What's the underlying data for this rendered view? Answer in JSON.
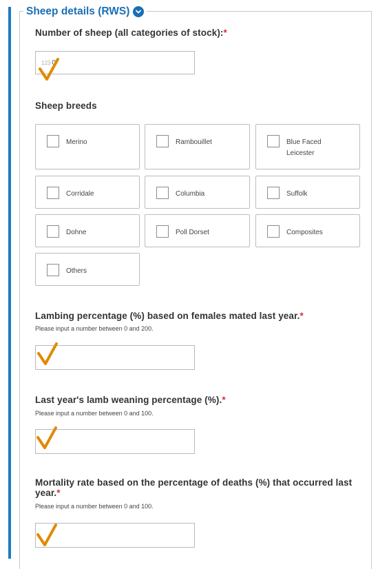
{
  "section": {
    "title": "Sheep details (RWS)"
  },
  "sheep_count": {
    "label": "Number of sheep (all categories of stock):",
    "required": "*",
    "value": "0",
    "type_icon": "123-icon"
  },
  "breeds": {
    "label": "Sheep breeds",
    "options": [
      {
        "label": "Merino",
        "checked": false
      },
      {
        "label": "Rambouillet",
        "checked": false
      },
      {
        "label": "Blue Faced Leicester",
        "checked": false
      },
      {
        "label": "Corridale",
        "checked": false
      },
      {
        "label": "Columbia",
        "checked": false
      },
      {
        "label": "Suffolk",
        "checked": false
      },
      {
        "label": "Dohne",
        "checked": false
      },
      {
        "label": "Poll Dorset",
        "checked": false
      },
      {
        "label": "Composites",
        "checked": false
      },
      {
        "label": "Others",
        "checked": false
      }
    ]
  },
  "lambing": {
    "label": "Lambing percentage (%) based on females mated last year.",
    "required": "*",
    "hint": "Please input a number between 0 and 200.",
    "value": ""
  },
  "weaning": {
    "label": "Last year's lamb weaning percentage (%).",
    "required": "*",
    "hint": "Please input a number between 0 and 100.",
    "value": ""
  },
  "mortality": {
    "label_line1": "Mortality rate based on the percentage of deaths (%) that occurred last",
    "label_line2": "year.",
    "required": "*",
    "hint": "Please input a number between 0 and 100.",
    "value": ""
  },
  "colors": {
    "accent": "#1a7cc1",
    "title": "#1a6fb5",
    "required": "#d6303b",
    "check_annotation": "#e08a00"
  }
}
